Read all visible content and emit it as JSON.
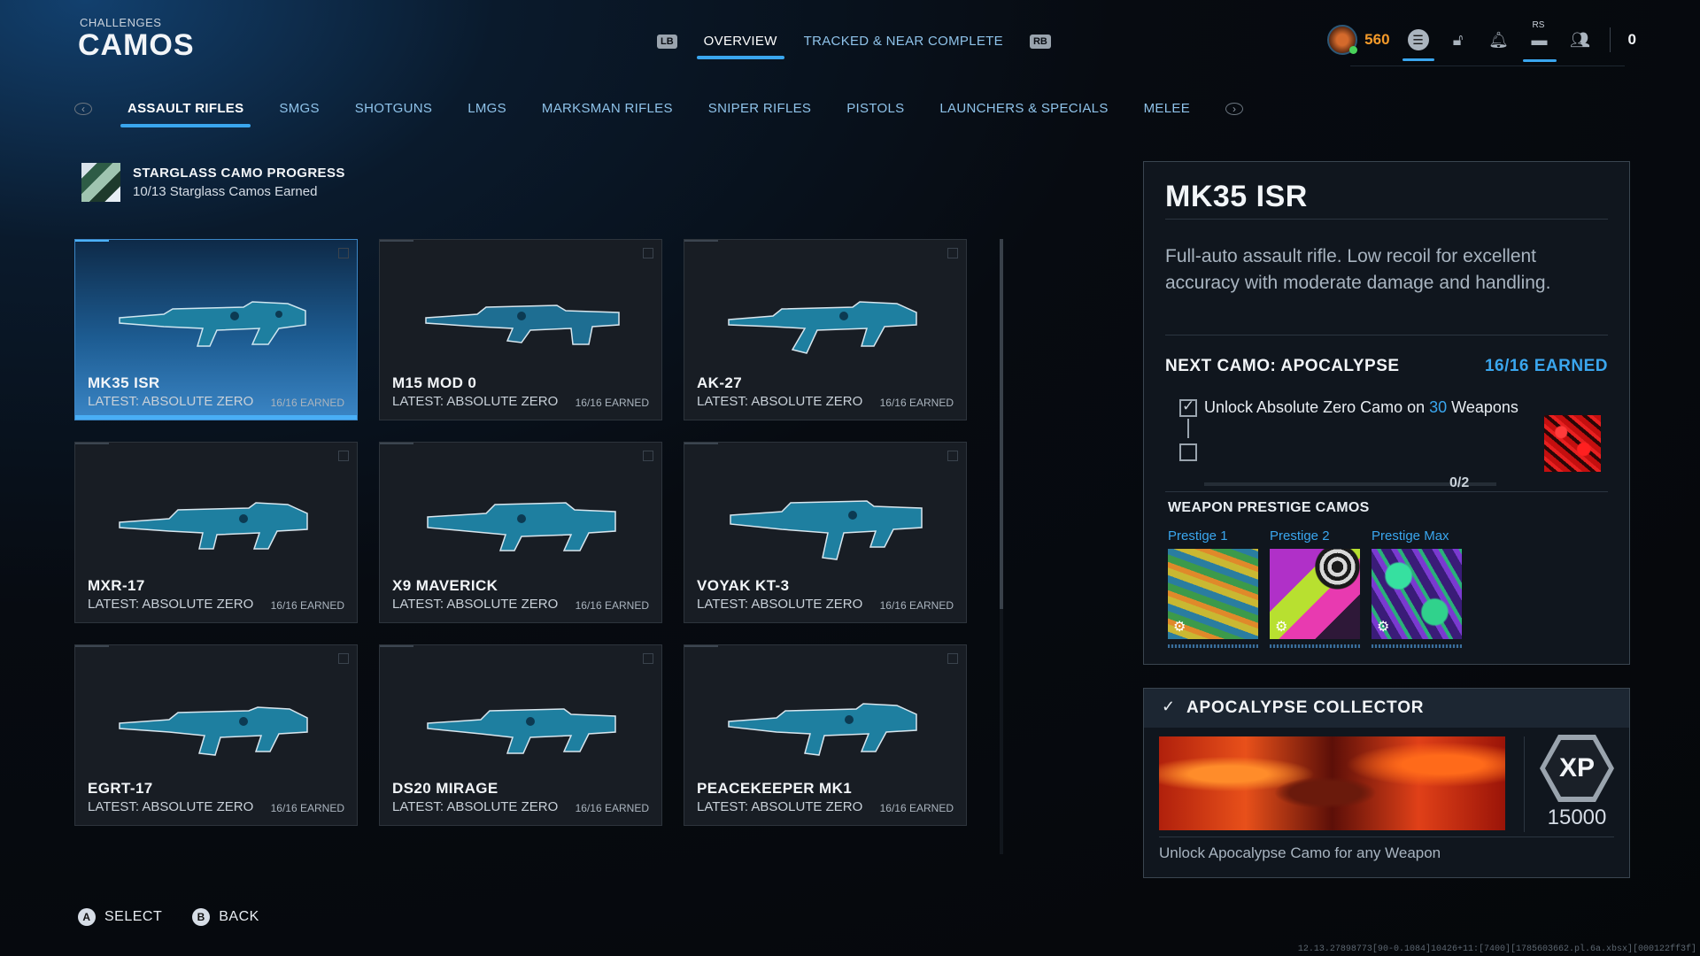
{
  "header": {
    "subtitle": "CHALLENGES",
    "title": "CAMOS"
  },
  "top_nav": {
    "left_bumper": "LB",
    "right_bumper": "RB",
    "tabs": [
      {
        "label": "OVERVIEW",
        "active": true
      },
      {
        "label": "TRACKED & NEAR COMPLETE",
        "active": false
      }
    ]
  },
  "status_bar": {
    "currency_icon": "cod-points-icon",
    "currency_value": "560",
    "rs_label": "RS",
    "party_count": "0"
  },
  "categories": [
    {
      "label": "ASSAULT RIFLES",
      "active": true
    },
    {
      "label": "SMGS",
      "active": false
    },
    {
      "label": "SHOTGUNS",
      "active": false
    },
    {
      "label": "LMGS",
      "active": false
    },
    {
      "label": "MARKSMAN RIFLES",
      "active": false
    },
    {
      "label": "SNIPER RIFLES",
      "active": false
    },
    {
      "label": "PISTOLS",
      "active": false
    },
    {
      "label": "LAUNCHERS & SPECIALS",
      "active": false
    },
    {
      "label": "MELEE",
      "active": false
    }
  ],
  "progress": {
    "title": "STARGLASS CAMO PROGRESS",
    "subtitle": "10/13 Starglass Camos Earned"
  },
  "weapons": [
    {
      "name": "MK35 ISR",
      "latest": "LATEST: ABSOLUTE ZERO",
      "earned": "16/16 EARNED",
      "selected": true
    },
    {
      "name": "M15 MOD 0",
      "latest": "LATEST: ABSOLUTE ZERO",
      "earned": "16/16 EARNED",
      "selected": false
    },
    {
      "name": "AK-27",
      "latest": "LATEST: ABSOLUTE ZERO",
      "earned": "16/16 EARNED",
      "selected": false
    },
    {
      "name": "MXR-17",
      "latest": "LATEST: ABSOLUTE ZERO",
      "earned": "16/16 EARNED",
      "selected": false
    },
    {
      "name": "X9 MAVERICK",
      "latest": "LATEST: ABSOLUTE ZERO",
      "earned": "16/16 EARNED",
      "selected": false
    },
    {
      "name": "VOYAK KT-3",
      "latest": "LATEST: ABSOLUTE ZERO",
      "earned": "16/16 EARNED",
      "selected": false
    },
    {
      "name": "EGRT-17",
      "latest": "LATEST: ABSOLUTE ZERO",
      "earned": "16/16 EARNED",
      "selected": false
    },
    {
      "name": "DS20 MIRAGE",
      "latest": "LATEST: ABSOLUTE ZERO",
      "earned": "16/16 EARNED",
      "selected": false
    },
    {
      "name": "PEACEKEEPER MK1",
      "latest": "LATEST: ABSOLUTE ZERO",
      "earned": "16/16 EARNED",
      "selected": false
    }
  ],
  "detail": {
    "title": "MK35 ISR",
    "description": "Full-auto assault rifle. Low recoil for excellent accuracy with moderate damage and handling.",
    "next_camo_label": "NEXT CAMO: APOCALYPSE",
    "next_camo_earned": "16/16 EARNED",
    "requirement_pre": "Unlock Absolute Zero Camo on ",
    "requirement_num": "30",
    "requirement_post": " Weapons",
    "requirement_progress": "0/2",
    "prestige_title": "WEAPON PRESTIGE CAMOS",
    "prestige": [
      {
        "label": "Prestige 1"
      },
      {
        "label": "Prestige 2"
      },
      {
        "label": "Prestige Max"
      }
    ]
  },
  "reward": {
    "title": "APOCALYPSE COLLECTOR",
    "xp_label": "XP",
    "xp_value": "15000",
    "description": "Unlock Apocalypse Camo for any Weapon"
  },
  "footer": {
    "select_glyph": "A",
    "select_label": "SELECT",
    "back_glyph": "B",
    "back_label": "BACK"
  },
  "build_string": "12.13.27898773[90-0.1084]10426+11:[7400][1785603662.pl.6a.xbsx][000122ff3f]",
  "colors": {
    "accent": "#3aa6ee",
    "currency": "#f49a2a",
    "panel": "#10161e"
  }
}
